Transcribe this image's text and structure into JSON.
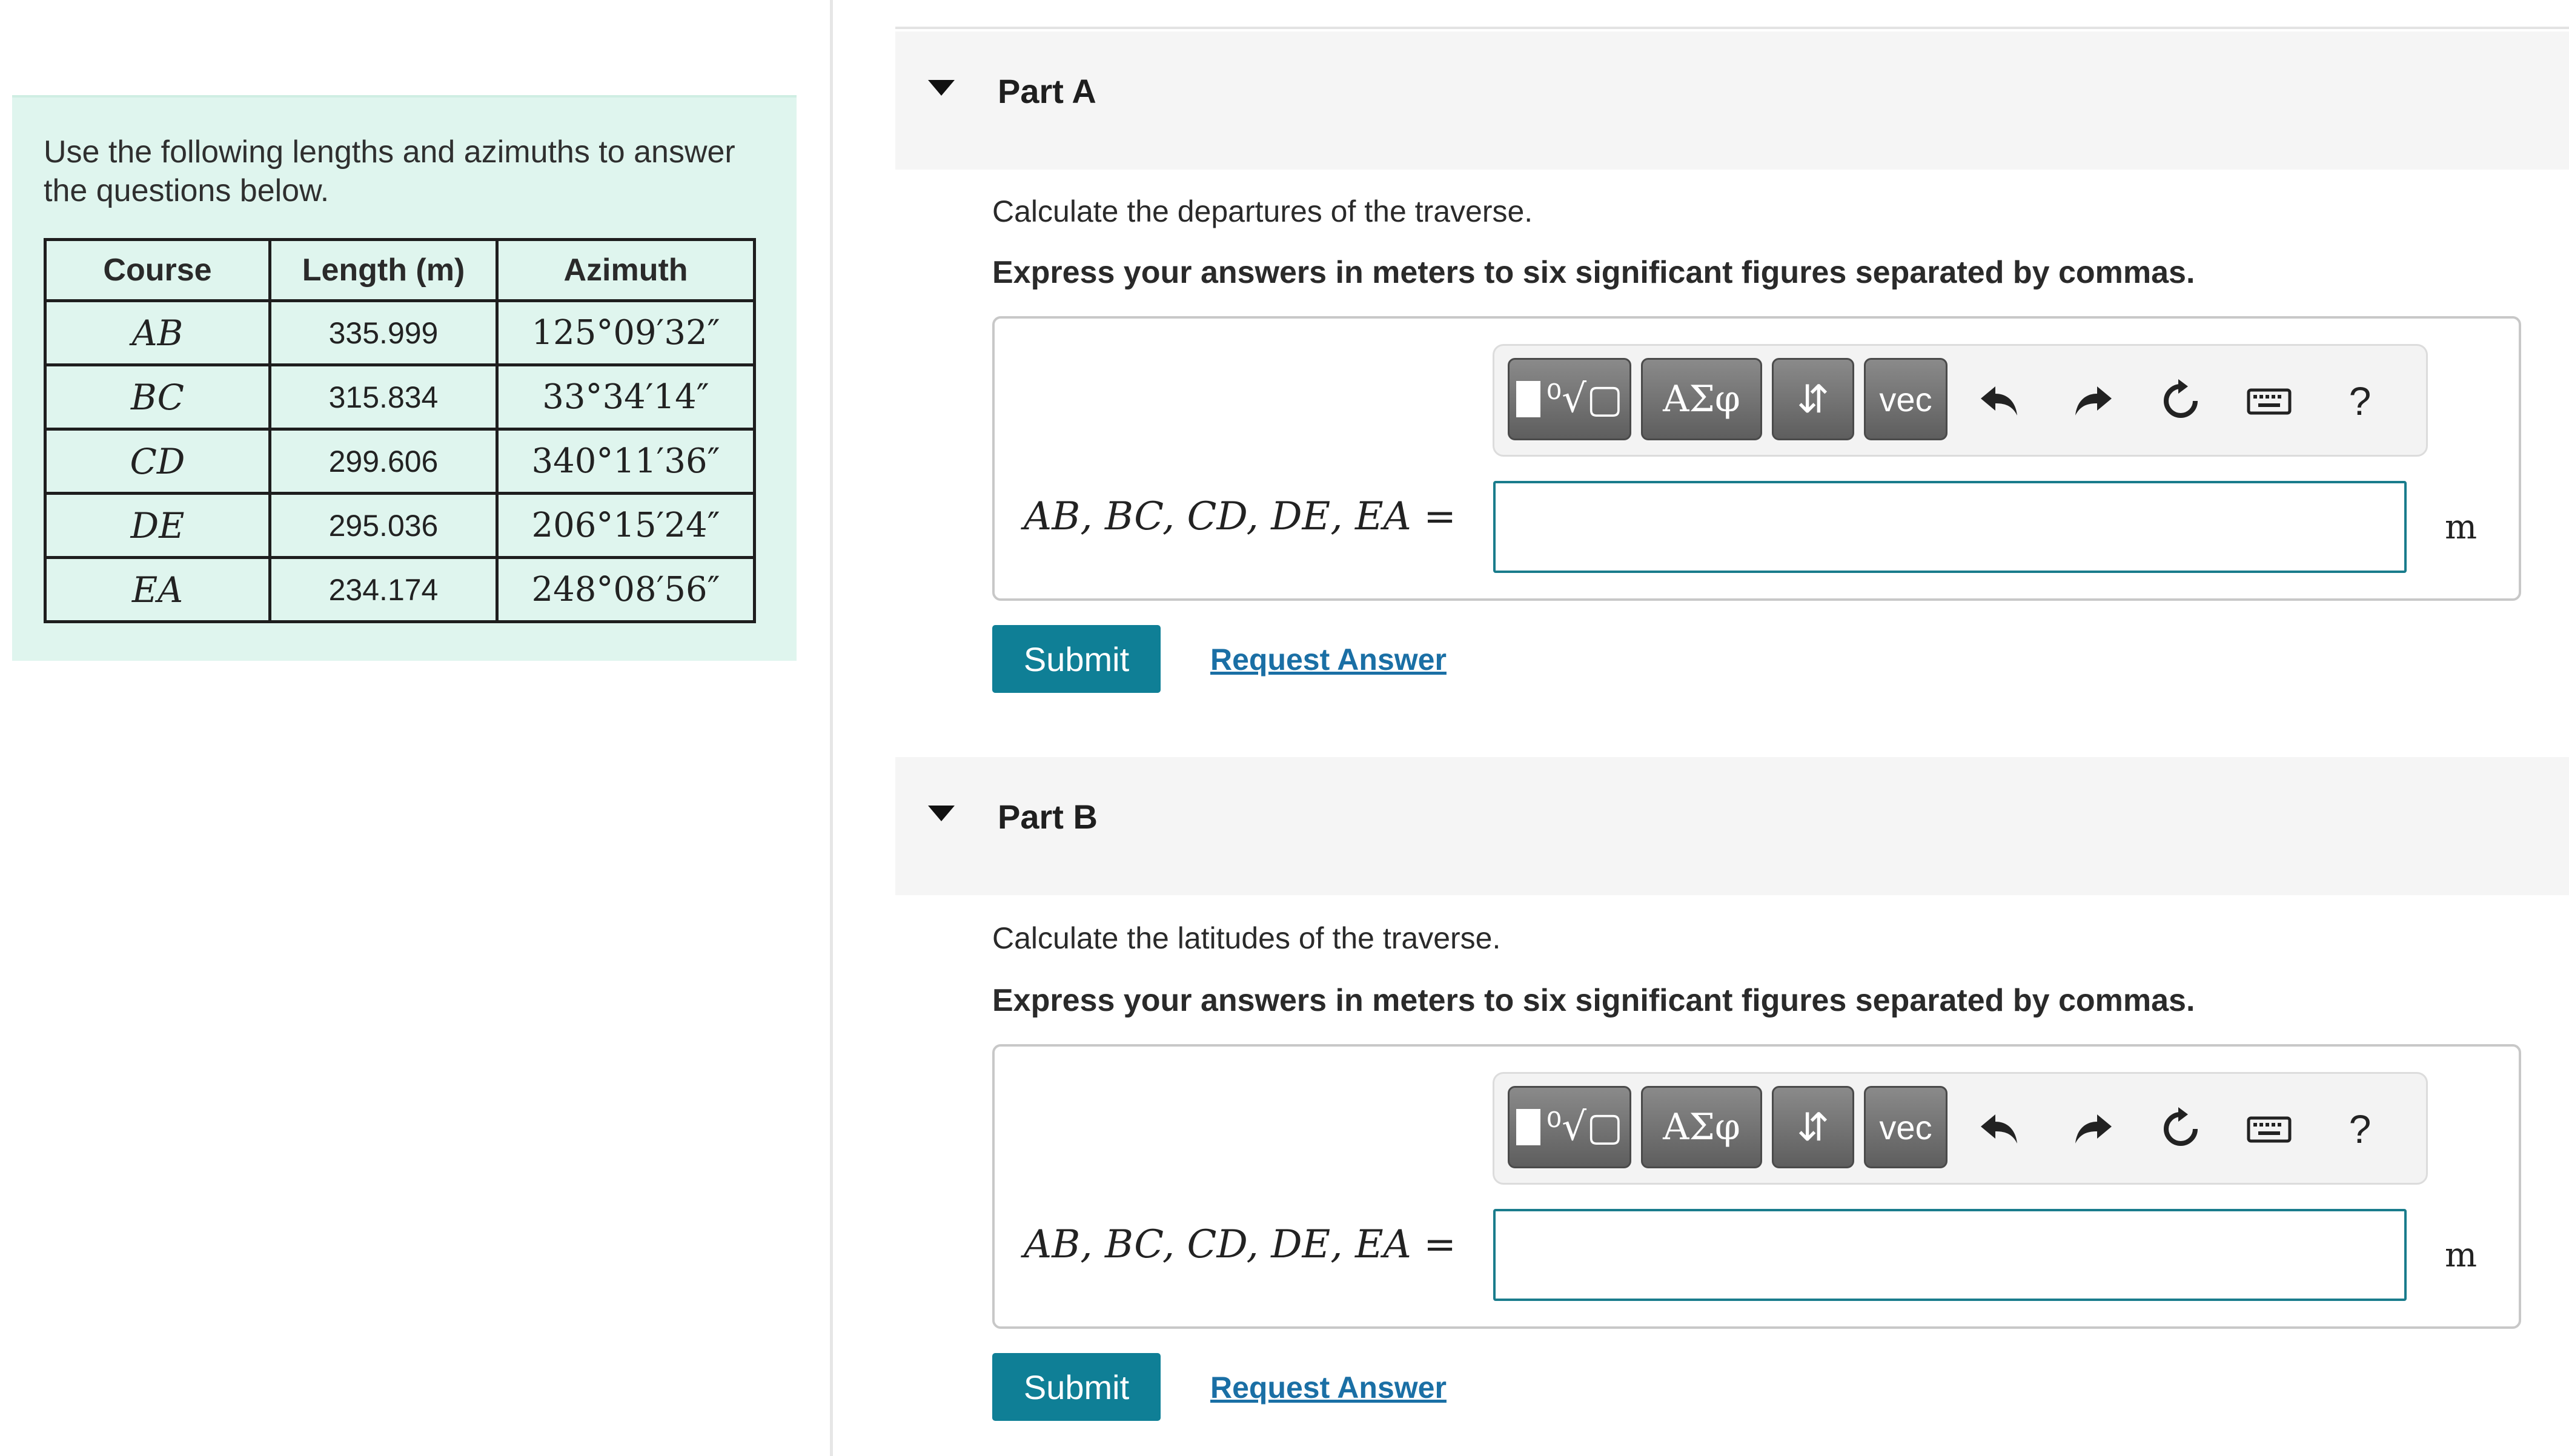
{
  "info": {
    "intro": "Use the following lengths and azimuths to answer the questions below.",
    "table": {
      "headers": [
        "Course",
        "Length (m)",
        "Azimuth"
      ],
      "rows": [
        {
          "course": "AB",
          "length": "335.999",
          "azimuth": "125°09′32″"
        },
        {
          "course": "BC",
          "length": "315.834",
          "azimuth": "33°34′14″"
        },
        {
          "course": "CD",
          "length": "299.606",
          "azimuth": "340°11′36″"
        },
        {
          "course": "DE",
          "length": "295.036",
          "azimuth": "206°15′24″"
        },
        {
          "course": "EA",
          "length": "234.174",
          "azimuth": "248°08′56″"
        }
      ]
    }
  },
  "toolbar": {
    "greek_label": "ΑΣφ",
    "arrows_label": "⇵",
    "vec_label": "vec",
    "help_label": "?"
  },
  "parts": [
    {
      "title": "Part A",
      "question": "Calculate the departures of the traverse.",
      "instruction": "Express your answers in meters to six significant figures separated by commas.",
      "equation_label": "AB, BC, CD, DE, EA",
      "equals": "=",
      "answer_value": "",
      "unit": "m",
      "submit_label": "Submit",
      "request_label": "Request Answer"
    },
    {
      "title": "Part B",
      "question": "Calculate the latitudes of the traverse.",
      "instruction": "Express your answers in meters to six significant figures separated by commas.",
      "equation_label": "AB, BC, CD, DE, EA",
      "equals": "=",
      "answer_value": "",
      "unit": "m",
      "submit_label": "Submit",
      "request_label": "Request Answer"
    }
  ],
  "colors": {
    "info_bg": "#dff5ee",
    "accent": "#0f7f96",
    "link": "#1a6fa5"
  }
}
